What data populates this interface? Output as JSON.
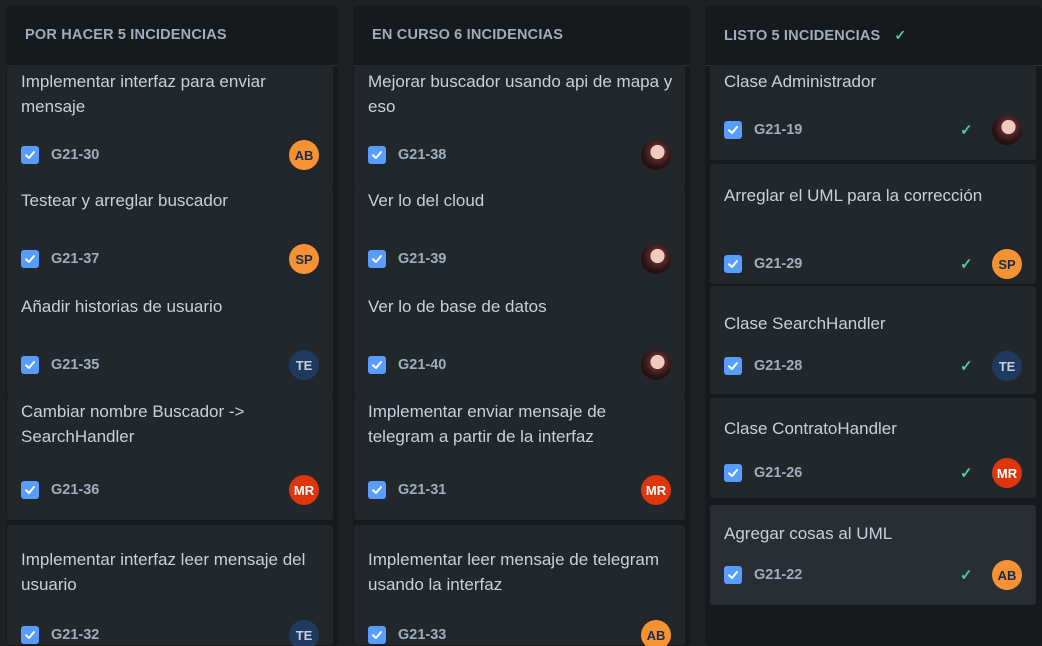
{
  "columns": [
    {
      "title": "POR HACER",
      "count": "5 INCIDENCIAS",
      "show_check": false,
      "cards": [
        {
          "title": "Implementar interfaz para enviar mensaje",
          "key": "G21-30",
          "avatar": "AB",
          "avatar_bg": "#f79232",
          "avatar_fg": "#172b4d"
        },
        {
          "title": "Testear y arreglar buscador",
          "key": "G21-37",
          "avatar": "SP",
          "avatar_bg": "#f79232",
          "avatar_fg": "#172b4d"
        },
        {
          "title": "Añadir historias de usuario",
          "key": "G21-35",
          "avatar": "TE",
          "avatar_bg": "#1f3a5f",
          "avatar_fg": "#c7d1db"
        },
        {
          "title": "Cambiar nombre Buscador -> SearchHandler",
          "key": "G21-36",
          "avatar": "MR",
          "avatar_bg": "#de350b",
          "avatar_fg": "#ffffff"
        },
        {
          "title": "Implementar interfaz leer mensaje del usuario",
          "key": "G21-32",
          "avatar": "TE",
          "avatar_bg": "#1f3a5f",
          "avatar_fg": "#c7d1db"
        }
      ]
    },
    {
      "title": "EN CURSO",
      "count": "6 INCIDENCIAS",
      "show_check": false,
      "cards": [
        {
          "title": "Mejorar buscador usando api de mapa y eso",
          "key": "G21-38",
          "avatar": "",
          "avatar_photo": true
        },
        {
          "title": "Ver lo del cloud",
          "key": "G21-39",
          "avatar": "",
          "avatar_photo": true
        },
        {
          "title": "Ver lo de base de datos",
          "key": "G21-40",
          "avatar": "",
          "avatar_photo": true
        },
        {
          "title": "Implementar enviar mensaje de telegram a partir de la interfaz",
          "key": "G21-31",
          "avatar": "MR",
          "avatar_bg": "#de350b",
          "avatar_fg": "#ffffff"
        },
        {
          "title": "Implementar leer mensaje de telegram usando la interfaz",
          "key": "G21-33",
          "avatar": "AB",
          "avatar_bg": "#f79232",
          "avatar_fg": "#172b4d"
        }
      ]
    },
    {
      "title": "LISTO",
      "count": "5 INCIDENCIAS",
      "show_check": true,
      "check_glyph": "✓",
      "cards": [
        {
          "title": "Clase Administrador",
          "key": "G21-19",
          "avatar": "",
          "avatar_photo": true,
          "done": "✓"
        },
        {
          "title": "Arreglar el UML para la corrección",
          "key": "G21-29",
          "avatar": "SP",
          "avatar_bg": "#f79232",
          "avatar_fg": "#172b4d",
          "done": "✓"
        },
        {
          "title": "Clase SearchHandler",
          "key": "G21-28",
          "avatar": "TE",
          "avatar_bg": "#1f3a5f",
          "avatar_fg": "#c7d1db",
          "done": "✓"
        },
        {
          "title": "Clase ContratoHandler",
          "key": "G21-26",
          "avatar": "MR",
          "avatar_bg": "#de350b",
          "avatar_fg": "#ffffff",
          "done": "✓"
        },
        {
          "title": "Agregar cosas al UML",
          "key": "G21-22",
          "avatar": "AB",
          "avatar_bg": "#f79232",
          "avatar_fg": "#172b4d",
          "done": "✓"
        }
      ]
    }
  ]
}
